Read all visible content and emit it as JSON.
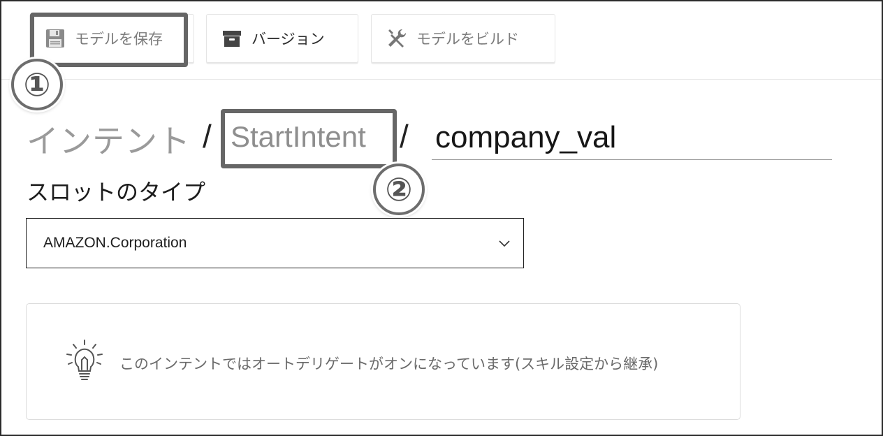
{
  "toolbar": {
    "save_label": "モデルを保存",
    "version_label": "バージョン",
    "build_label": "モデルをビルド"
  },
  "annotations": {
    "marker_1": "①",
    "marker_2": "②"
  },
  "breadcrumb": {
    "intents": "インテント",
    "separator": "/",
    "intent_name": "StartIntent",
    "slot_name": "company_val"
  },
  "slot_type": {
    "label": "スロットのタイプ",
    "selected_value": "AMAZON.Corporation"
  },
  "info": {
    "text": "このインテントではオートデリゲートがオンになっています(",
    "link": "スキル設定",
    "text_end": "から継承)"
  },
  "icons": [
    "save-icon",
    "archive-icon",
    "build-tools-icon",
    "chevron-down-icon",
    "lightbulb-icon"
  ]
}
